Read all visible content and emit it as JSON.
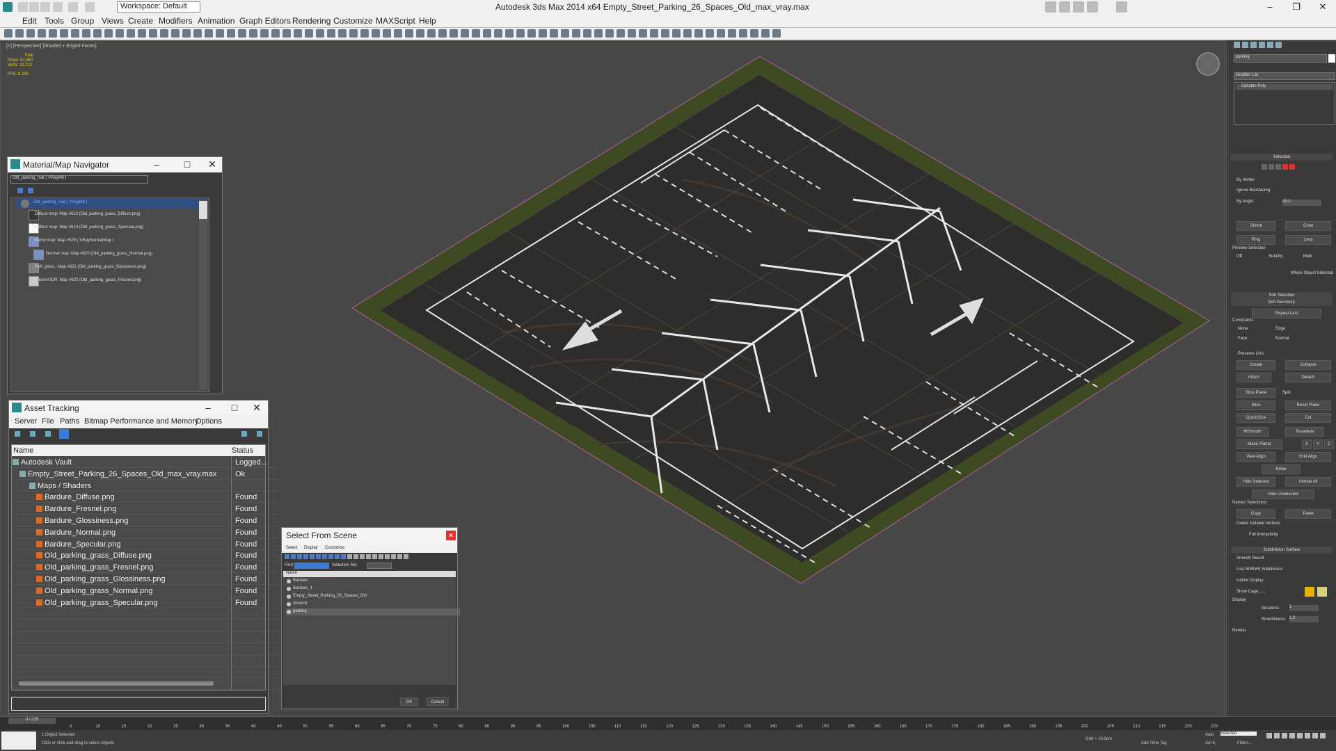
{
  "titlebar": {
    "title": "Autodesk 3ds Max  2014 x64     Empty_Street_Parking_26_Spaces_Old_max_vray.max",
    "workspace": "Workspace: Default"
  },
  "menu": [
    "Edit",
    "Tools",
    "Group",
    "Views",
    "Create",
    "Modifiers",
    "Animation",
    "Graph Editors",
    "Rendering",
    "Customize",
    "MAXScript",
    "Help"
  ],
  "viewport": {
    "label": "[+] [Perspective] [Shaded + Edged Faces]",
    "stats_total": "Total",
    "stats_polys": "Polys:   62,982",
    "stats_verts": "Verts:   31,222",
    "stats_fps": "FPS:     8.239"
  },
  "material_navigator": {
    "title": "Material/Map Navigator",
    "field": "Old_parking_mat  ( VRayMtl )",
    "root": "Old_parking_mat  ( VRayMtl )",
    "items": [
      "Diffuse map: Map #623 (Old_parking_grass_Diffuse.png)",
      "Reflect map: Map #624 (Old_parking_grass_Specular.png)",
      "Bump map: Map #625  ( VRayNormalMap )",
      "Normal map: Map #620 (Old_parking_grass_Normal.png)",
      "Refl. gloss.: Map #621 (Old_parking_grass_Glossiness.png)",
      "Fresnel IOR: Map #622 (Old_parking_grass_Fresnel.png)"
    ]
  },
  "asset_tracking": {
    "title": "Asset Tracking",
    "menu": [
      "Server",
      "File",
      "Paths",
      "Bitmap Performance and Memory",
      "Options"
    ],
    "col_name": "Name",
    "col_status": "Status",
    "rows": [
      {
        "name": "Autodesk Vault",
        "status": "Logged..."
      },
      {
        "name": "Empty_Street_Parking_26_Spaces_Old_max_vray.max",
        "status": "Ok"
      },
      {
        "name": "Maps / Shaders",
        "status": ""
      },
      {
        "name": "Bardure_Diffuse.png",
        "status": "Found"
      },
      {
        "name": "Bardure_Fresnel.png",
        "status": "Found"
      },
      {
        "name": "Bardure_Glossiness.png",
        "status": "Found"
      },
      {
        "name": "Bardure_Normal.png",
        "status": "Found"
      },
      {
        "name": "Bardure_Specular.png",
        "status": "Found"
      },
      {
        "name": "Old_parking_grass_Diffuse.png",
        "status": "Found"
      },
      {
        "name": "Old_parking_grass_Fresnel.png",
        "status": "Found"
      },
      {
        "name": "Old_parking_grass_Glossiness.png",
        "status": "Found"
      },
      {
        "name": "Old_parking_grass_Normal.png",
        "status": "Found"
      },
      {
        "name": "Old_parking_grass_Specular.png",
        "status": "Found"
      }
    ]
  },
  "select_from_scene": {
    "title": "Select From Scene",
    "menu": [
      "Select",
      "Display",
      "Customize"
    ],
    "find_label": "Find:",
    "selection_set": "Selection Set:",
    "col_name": "Name",
    "items": [
      "Bardure",
      "Bardure_1",
      "Empty_Street_Parking_26_Spaces_Old",
      "Ground",
      "parking"
    ],
    "ok": "OK",
    "cancel": "Cancel"
  },
  "command_panel": {
    "object_name": "parking",
    "modifier_list": "Modifier List",
    "stack_item": "Editable Poly",
    "selection_head": "Selection",
    "by_vertex": "By Vertex",
    "ignore_backfacing": "Ignore Backfacing",
    "by_angle": "By Angle:",
    "angle_val": "45.0",
    "shrink": "Shrink",
    "grow": "Grow",
    "ring": "Ring",
    "loop": "Loop",
    "preview_selection": "Preview Selection",
    "off": "Off",
    "subobj": "SubObj",
    "multi": "Multi",
    "whole_selected": "Whole Object Selected",
    "soft_selection": "Soft Selection",
    "edit_geometry": "Edit Geometry",
    "repeat_last": "Repeat Last",
    "constraints": "Constraints",
    "none": "None",
    "edge": "Edge",
    "face": "Face",
    "normal": "Normal",
    "preserve_uvs": "Preserve UVs",
    "create": "Create",
    "collapse": "Collapse",
    "attach": "Attach",
    "detach": "Detach",
    "slice_plane": "Slice Plane",
    "split": "Split",
    "slice": "Slice",
    "reset_plane": "Reset Plane",
    "quickslice": "QuickSlice",
    "cut": "Cut",
    "msmooth": "MSmooth",
    "tessellate": "Tessellate",
    "make_planar": "Make Planar",
    "x": "X",
    "y": "Y",
    "z": "Z",
    "view_align": "View Align",
    "grid_align": "Grid Align",
    "relax": "Relax",
    "hide_selected": "Hide Selected",
    "unhide_all": "Unhide All",
    "hide_unselected": "Hide Unselected",
    "named_selections": "Named Selections:",
    "copy": "Copy",
    "paste": "Paste",
    "delete_isolated": "Delete Isolated Vertices",
    "full_interactivity": "Full Interactivity",
    "subdivision_surface": "Subdivision Surface",
    "smooth_result": "Smooth Result",
    "use_nurms": "Use NURMS Subdivision",
    "isoline_display": "Isoline Display",
    "show_cage": "Show Cage.......",
    "display": "Display",
    "iterations": "Iterations:",
    "iterations_val": "1",
    "smoothness": "Smoothness:",
    "smoothness_val": "1.0",
    "render": "Render"
  },
  "timeline": {
    "frame": "0 / 225",
    "ticks": [
      "0",
      "10",
      "15",
      "20",
      "25",
      "30",
      "35",
      "40",
      "45",
      "50",
      "55",
      "60",
      "65",
      "70",
      "75",
      "80",
      "85",
      "90",
      "95",
      "100",
      "105",
      "110",
      "115",
      "120",
      "125",
      "130",
      "135",
      "140",
      "145",
      "150",
      "155",
      "160",
      "165",
      "170",
      "175",
      "180",
      "185",
      "190",
      "195",
      "200",
      "205",
      "210",
      "215",
      "220",
      "225"
    ]
  },
  "statusbar": {
    "objects": "1 Object Selected",
    "hint": "Click or click-and-drag to select objects",
    "grid": "Grid = 10.0cm",
    "autokey": "Auto",
    "selected": "Selected",
    "setkey": "Set K.",
    "filters": "Filters...",
    "add_time_tag": "Add Time Tag"
  },
  "colors": {
    "swatch1": "#e8b400",
    "swatch2": "#d8d080",
    "grass": "#3e4a22",
    "asphalt": "#2f2d2b"
  }
}
